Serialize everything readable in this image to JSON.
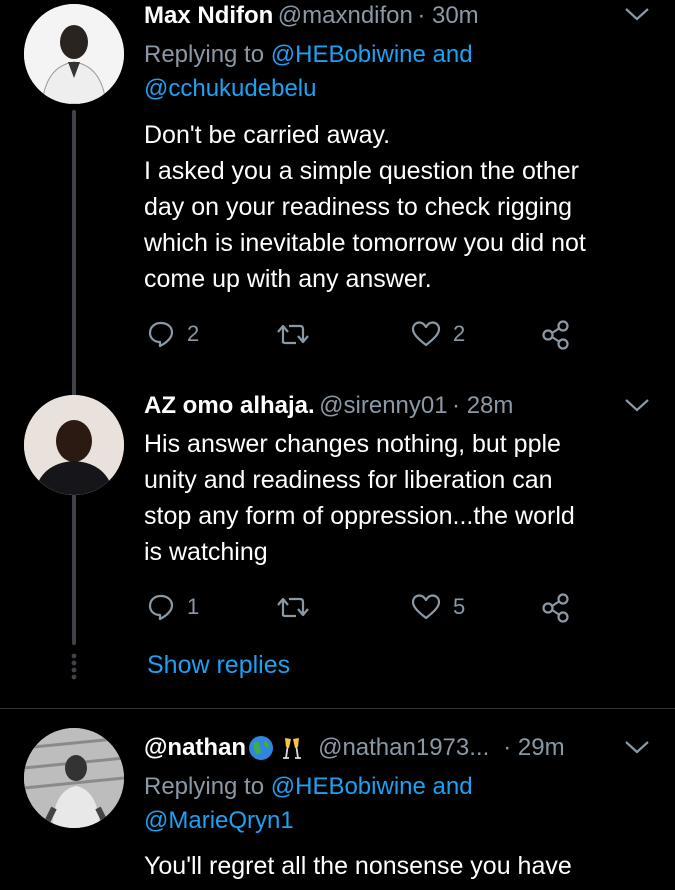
{
  "tweets": [
    {
      "name": "Max Ndifon",
      "handle": "@maxndifon",
      "time": "· 30m",
      "replying_prefix": "Replying to ",
      "mention1": "@HEBobiwine",
      "and": " and",
      "mention2": "@cchukudebelu",
      "lines": [
        "Don't be carried away.",
        "I asked you a simple question the other",
        "day on your readiness to check rigging",
        "which is inevitable tomorrow you did not",
        "come up with any answer."
      ],
      "replies": "2",
      "likes": "2"
    },
    {
      "name": "AZ omo alhaja.",
      "handle": "@sirenny01",
      "time": "· 28m",
      "lines": [
        "His answer changes nothing, but pple",
        "unity and readiness for liberation can",
        "stop any form of oppression...the world",
        "is watching"
      ],
      "replies": "1",
      "likes": "5"
    },
    {
      "name": "@nathan",
      "handle": "@nathan1973...",
      "time": "· 29m",
      "replying_prefix": "Replying to ",
      "mention1": "@HEBobiwine",
      "and": " and",
      "mention2": "@MarieQryn1",
      "lines": [
        "You'll regret all the nonsense you have"
      ]
    }
  ],
  "show_replies": "Show replies",
  "colors": {
    "accent": "#1da1f2",
    "muted": "#8b98a5",
    "background": "#000000"
  }
}
